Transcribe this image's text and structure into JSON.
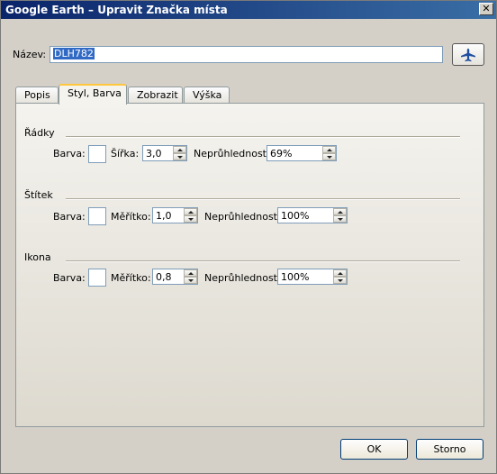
{
  "window": {
    "title": "Google Earth – Upravit Značka místa"
  },
  "name_field": {
    "label": "Název:",
    "value": "DLH782",
    "icon": "airplane-icon"
  },
  "tabs": [
    {
      "label": "Popis",
      "active": false
    },
    {
      "label": "Styl, Barva",
      "active": true
    },
    {
      "label": "Zobrazit",
      "active": false
    },
    {
      "label": "Výška",
      "active": false
    }
  ],
  "groups": {
    "lines": {
      "title": "Řádky",
      "color_label": "Barva:",
      "size_label": "Šířka:",
      "size_value": "3,0",
      "opacity_label": "Neprůhlednost:",
      "opacity_value": "69%"
    },
    "label": {
      "title": "Štítek",
      "color_label": "Barva:",
      "size_label": "Měřítko:",
      "size_value": "1,0",
      "opacity_label": "Neprůhlednost:",
      "opacity_value": "100%"
    },
    "icon": {
      "title": "Ikona",
      "color_label": "Barva:",
      "size_label": "Měřítko:",
      "size_value": "0,8",
      "opacity_label": "Neprůhlednost:",
      "opacity_value": "100%"
    }
  },
  "buttons": {
    "ok": "OK",
    "cancel": "Storno"
  }
}
